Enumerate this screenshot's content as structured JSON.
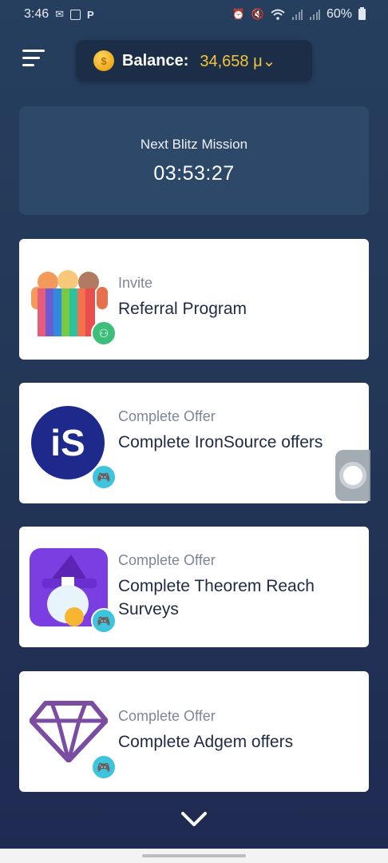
{
  "status_bar": {
    "time": "3:46",
    "battery": "60%",
    "left_icons": [
      "message-icon",
      "screen-icon",
      "p-icon"
    ],
    "right_icons": [
      "alarm-icon",
      "mute-icon",
      "wifi-icon",
      "signal-icon",
      "signal-icon",
      "battery-icon"
    ]
  },
  "header": {
    "menu_icon": "hamburger-menu-icon",
    "balance_label": "Balance:",
    "balance_value": "34,658",
    "currency_symbol": "μ",
    "coin_icon": "coin-icon"
  },
  "mission": {
    "title": "Next Blitz Mission",
    "timer": "03:53:27"
  },
  "offers": [
    {
      "type": "Invite",
      "title": "Referral Program",
      "logo": "people-icon",
      "badge_icon": "link-icon",
      "badge_color": "#3dbf7a"
    },
    {
      "type": "Complete Offer",
      "title": "Complete IronSource offers",
      "logo": "ironsource-logo",
      "badge_icon": "gamepad-icon",
      "badge_color": "#3ec4dd"
    },
    {
      "type": "Complete Offer",
      "title": "Complete Theorem Reach Surveys",
      "logo": "wizard-logo",
      "badge_icon": "gamepad-icon",
      "badge_color": "#3ec4dd"
    },
    {
      "type": "Complete Offer",
      "title": "Complete Adgem offers",
      "logo": "gem-logo",
      "badge_icon": "gamepad-icon",
      "badge_color": "#3ec4dd"
    }
  ],
  "colors": {
    "background": "#233757",
    "mission_card": "#2d4868",
    "balance_value": "#f3c33b",
    "card": "#ffffff"
  },
  "footer": {
    "scroll_icon": "chevron-down-icon"
  }
}
